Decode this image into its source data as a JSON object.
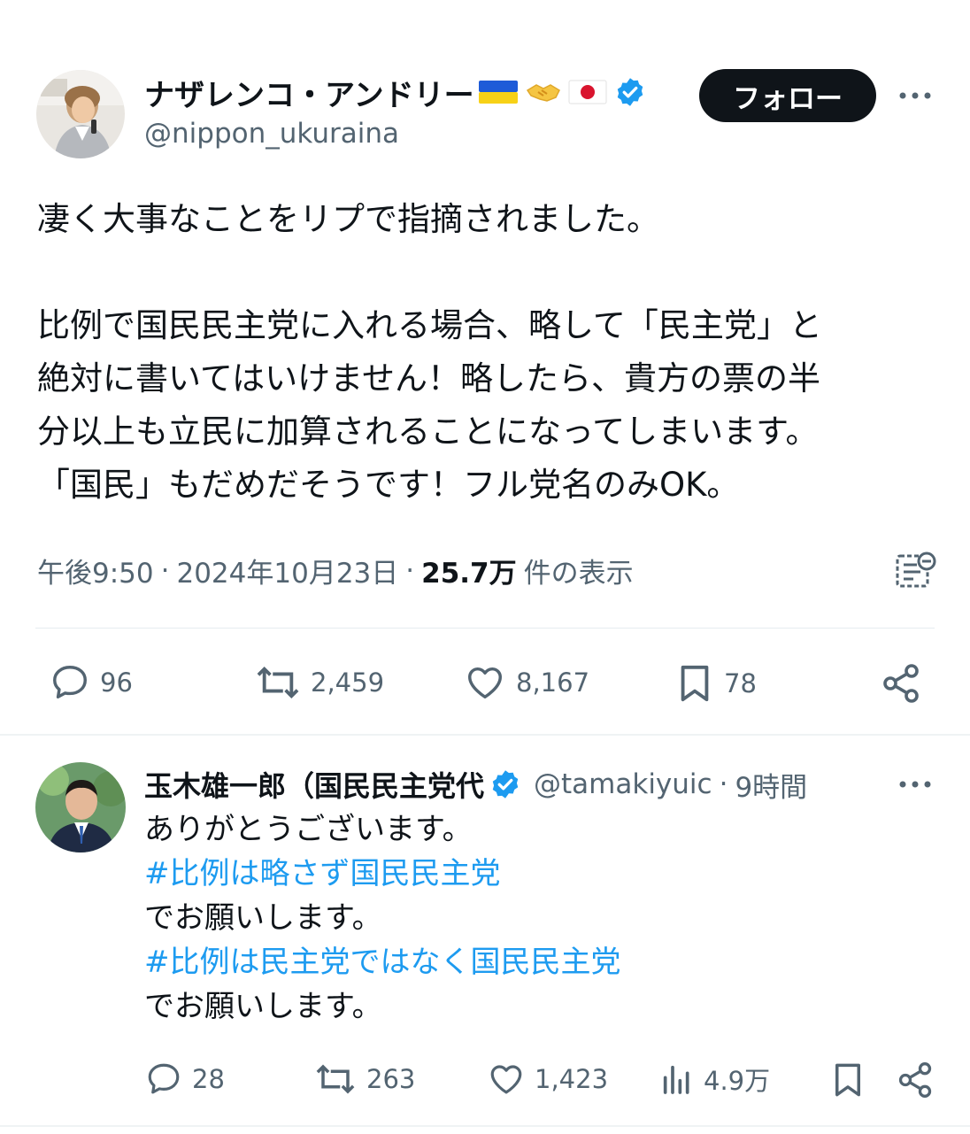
{
  "tweet": {
    "author": {
      "name": "ナザレンコ・アンドリー",
      "name_emojis": "🇺🇦🫱🏻‍🫲🏼🇯🇵",
      "handle": "@nippon_ukuraina",
      "verified": true
    },
    "follow_label": "フォロー",
    "more_label": "···",
    "body_lines": [
      "凄く大事なことをリプで指摘されました。",
      "",
      "比例で国民民主党に入れる場合、略して「民主党」と",
      "絶対に書いてはいけません！略したら、貴方の票の半",
      "分以上も立民に加算されることになってしまいます。",
      "「国民」もだめだそうです！フル党名のみOK。"
    ],
    "meta": {
      "time": "午後9:50",
      "sep1": "·",
      "date": "2024年10月23日",
      "sep2": "·",
      "views": "25.7万",
      "views_suffix": "件の表示"
    },
    "actions": {
      "replies": "96",
      "retweets": "2,459",
      "likes": "8,167",
      "bookmarks": "78"
    }
  },
  "reply": {
    "author": {
      "name": "玉木雄一郎（国民民主党代",
      "handle": "@tamakiyuic",
      "sep": "·",
      "time": "9時間",
      "verified": true
    },
    "more_label": "···",
    "lines": [
      {
        "text": "ありがとうございます。",
        "hashtag": false
      },
      {
        "text": "#比例は略さず国民民主党",
        "hashtag": true
      },
      {
        "text": "でお願いします。",
        "hashtag": false
      },
      {
        "text": "#比例は民主党ではなく国民民主党",
        "hashtag": true
      },
      {
        "text": "でお願いします。",
        "hashtag": false
      }
    ],
    "actions": {
      "replies": "28",
      "retweets": "263",
      "likes": "1,423",
      "views": "4.9万"
    }
  },
  "colors": {
    "text": "#0f1419",
    "muted": "#536471",
    "link": "#1d9bf0",
    "verified": "#1d9bf0",
    "follow_bg": "#0f1419"
  }
}
